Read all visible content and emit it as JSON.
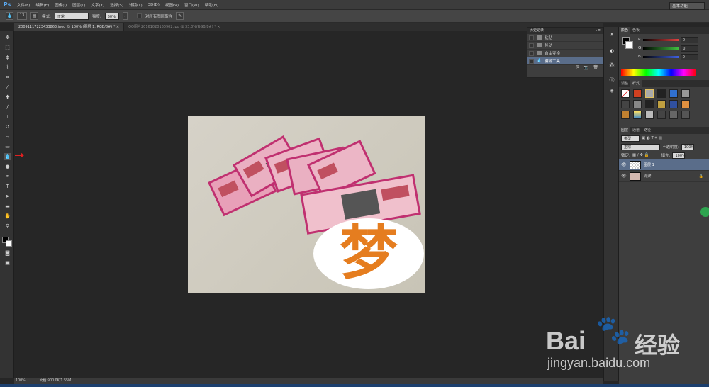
{
  "app": {
    "logo": "Ps"
  },
  "menu": [
    "文件(F)",
    "编辑(E)",
    "图像(I)",
    "图层(L)",
    "文字(Y)",
    "选择(S)",
    "滤镜(T)",
    "3D(D)",
    "视图(V)",
    "窗口(W)",
    "帮助(H)"
  ],
  "options": {
    "brush_size": "13",
    "mode_label": "模式:",
    "mode_value": "正常",
    "strength_label": "强度:",
    "strength_value": "50%",
    "sample_all_layers": "对所有图层取样",
    "workspace": "基本功能"
  },
  "tabs": [
    {
      "label": "20091117223433863.jpeg @ 100% (图层 1, RGB/8#) *",
      "close": "×"
    },
    {
      "label": "QQ图片20161020160902.jpg @ 33.3%(RGB/8#) *",
      "close": "×"
    }
  ],
  "history": {
    "title": "历史记录",
    "items": [
      {
        "label": "粘贴",
        "selected": false
      },
      {
        "label": "移动",
        "selected": false
      },
      {
        "label": "自由变换",
        "selected": false
      },
      {
        "label": "模糊工具",
        "selected": true
      }
    ]
  },
  "color_panel": {
    "tabs": [
      "颜色",
      "色板"
    ],
    "channels": [
      {
        "name": "R",
        "value": "0",
        "color": "#e04040"
      },
      {
        "name": "G",
        "value": "0",
        "color": "#40c040"
      },
      {
        "name": "B",
        "value": "0",
        "color": "#4060e0"
      }
    ]
  },
  "style_panel": {
    "tabs": [
      "调整",
      "样式"
    ]
  },
  "layers_panel": {
    "tabs": [
      "图层",
      "通道",
      "路径"
    ],
    "kind_label": "类型",
    "blend_mode": "正常",
    "opacity_label": "不透明度:",
    "opacity_value": "100%",
    "lock_label": "锁定:",
    "fill_label": "填充:",
    "fill_value": "100%",
    "layers": [
      {
        "name": "图层 1",
        "selected": true
      },
      {
        "name": "背景",
        "selected": false,
        "locked": true
      }
    ]
  },
  "status": {
    "zoom": "100%",
    "doc_info": "文档:900.0K/1.55M"
  },
  "canvas": {
    "overlay_char": "梦"
  },
  "watermark": {
    "brand": "Bai",
    "brand_cn": "经验",
    "url": "jingyan.baidu.com"
  }
}
